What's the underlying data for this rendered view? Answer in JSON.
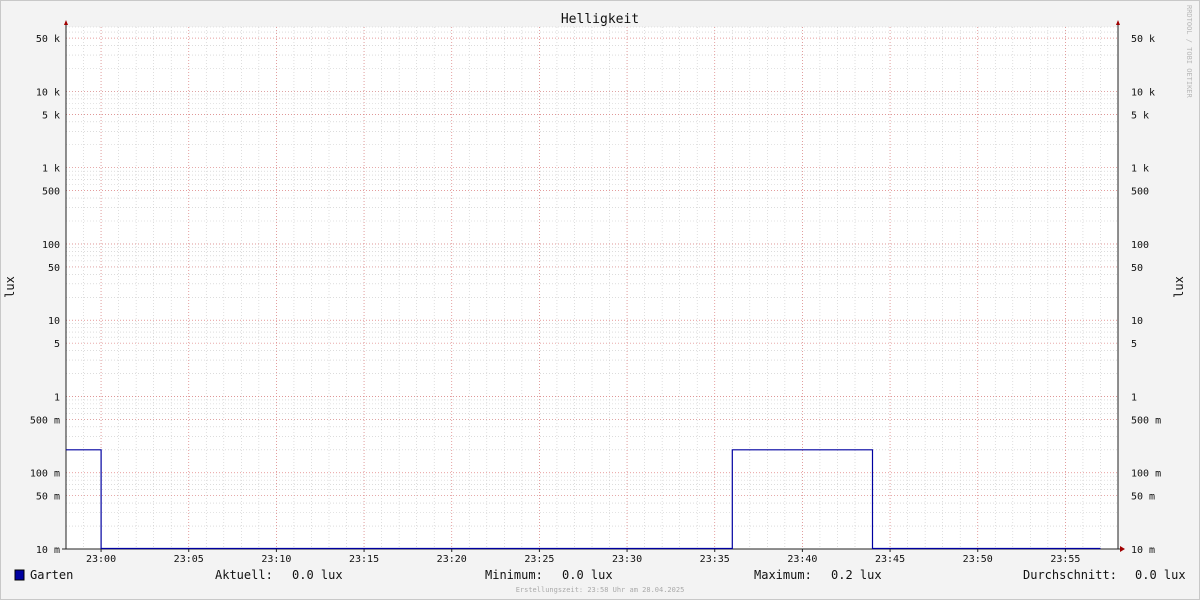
{
  "chart_data": {
    "type": "line",
    "title": "Helligkeit",
    "ylabel": "lux",
    "ylabel_right": "lux",
    "watermark": "RRDTOOL / TOBI OETIKER",
    "footer": "Erstellungszeit: 23:58 Uhr am 28.04.2025",
    "yscale": "log",
    "ylim": [
      0.01,
      70000
    ],
    "xlim_minutes_after_2300": [
      -2,
      58
    ],
    "x_ticks": [
      {
        "t": 0,
        "label": "23:00"
      },
      {
        "t": 5,
        "label": "23:05"
      },
      {
        "t": 10,
        "label": "23:10"
      },
      {
        "t": 15,
        "label": "23:15"
      },
      {
        "t": 20,
        "label": "23:20"
      },
      {
        "t": 25,
        "label": "23:25"
      },
      {
        "t": 30,
        "label": "23:30"
      },
      {
        "t": 35,
        "label": "23:35"
      },
      {
        "t": 40,
        "label": "23:40"
      },
      {
        "t": 45,
        "label": "23:45"
      },
      {
        "t": 50,
        "label": "23:50"
      },
      {
        "t": 55,
        "label": "23:55"
      }
    ],
    "y_ticks": [
      {
        "v": 0.01,
        "label": "10 m"
      },
      {
        "v": 0.05,
        "label": "50 m"
      },
      {
        "v": 0.1,
        "label": "100 m"
      },
      {
        "v": 0.5,
        "label": "500 m"
      },
      {
        "v": 1,
        "label": "1"
      },
      {
        "v": 5,
        "label": "5"
      },
      {
        "v": 10,
        "label": "10"
      },
      {
        "v": 50,
        "label": "50"
      },
      {
        "v": 100,
        "label": "100"
      },
      {
        "v": 500,
        "label": "500"
      },
      {
        "v": 1000,
        "label": "1 k"
      },
      {
        "v": 5000,
        "label": "5 k"
      },
      {
        "v": 10000,
        "label": "10 k"
      },
      {
        "v": 50000,
        "label": "50 k"
      }
    ],
    "series": [
      {
        "name": "Garten",
        "color": "#0000a0",
        "points": [
          {
            "t": -2,
            "v": 0.2
          },
          {
            "t": 0,
            "v": 0.2
          },
          {
            "t": 0,
            "v": 0.01
          },
          {
            "t": 36,
            "v": 0.01
          },
          {
            "t": 36,
            "v": 0.2
          },
          {
            "t": 44,
            "v": 0.2
          },
          {
            "t": 44,
            "v": 0.01
          },
          {
            "t": 57,
            "v": 0.01
          }
        ]
      }
    ],
    "grid": true,
    "legend_position": "bottom"
  },
  "legend": {
    "series_name": "Garten",
    "swatch_color": "#0000a0",
    "stats": [
      {
        "label": "Aktuell:",
        "value": "0.0 lux"
      },
      {
        "label": "Minimum:",
        "value": "0.0 lux"
      },
      {
        "label": "Maximum:",
        "value": "0.2 lux"
      },
      {
        "label": "Durchschnitt:",
        "value": "0.0 lux"
      }
    ]
  }
}
